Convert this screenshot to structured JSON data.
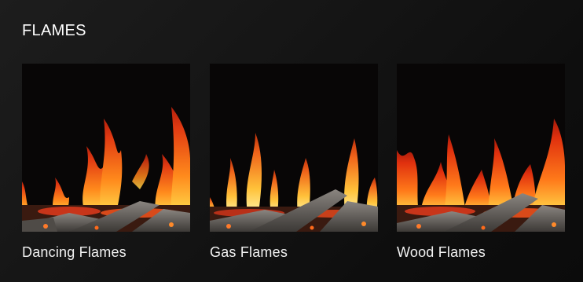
{
  "section": {
    "title": "FLAMES"
  },
  "options": [
    {
      "label": "Dancing Flames",
      "image": "dancing-flames-thumbnail"
    },
    {
      "label": "Gas Flames",
      "image": "gas-flames-thumbnail"
    },
    {
      "label": "Wood Flames",
      "image": "wood-flames-thumbnail"
    }
  ],
  "colors": {
    "background": "#121212",
    "text": "#ffffff",
    "flame_outer": "#e23a12",
    "flame_mid": "#ff8a1c",
    "flame_core": "#ffd84a",
    "ember": "#c8351a",
    "log": "#6e6a66"
  }
}
